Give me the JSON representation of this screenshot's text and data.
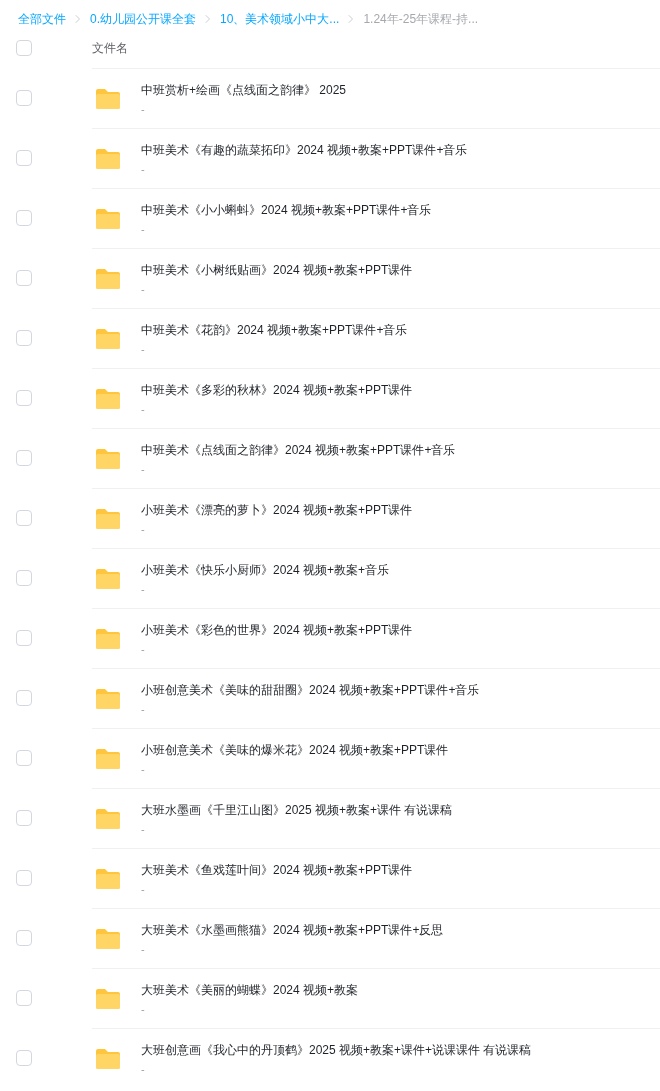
{
  "breadcrumb": [
    {
      "label": "全部文件",
      "selected": false
    },
    {
      "label": "0.幼儿园公开课全套",
      "selected": false
    },
    {
      "label": "10、美术领域小中大...",
      "selected": false
    },
    {
      "label": "1.24年-25年课程-持...",
      "selected": true
    }
  ],
  "table": {
    "select_all": {
      "checked": false
    },
    "columns": [
      "文件名"
    ],
    "rows": [
      {
        "name": "中班赏析+绘画《点线面之韵律》 2025",
        "detail": "-",
        "checked": false
      },
      {
        "name": "中班美术《有趣的蔬菜拓印》2024 视频+教案+PPT课件+音乐",
        "detail": "-",
        "checked": false
      },
      {
        "name": "中班美术《小小蝌蚪》2024 视频+教案+PPT课件+音乐",
        "detail": "-",
        "checked": false
      },
      {
        "name": "中班美术《小树纸贴画》2024 视频+教案+PPT课件",
        "detail": "-",
        "checked": false
      },
      {
        "name": "中班美术《花韵》2024 视频+教案+PPT课件+音乐",
        "detail": "-",
        "checked": false
      },
      {
        "name": "中班美术《多彩的秋林》2024 视频+教案+PPT课件",
        "detail": "-",
        "checked": false
      },
      {
        "name": "中班美术《点线面之韵律》2024 视频+教案+PPT课件+音乐",
        "detail": "-",
        "checked": false
      },
      {
        "name": "小班美术《漂亮的萝卜》2024 视频+教案+PPT课件",
        "detail": "-",
        "checked": false
      },
      {
        "name": "小班美术《快乐小厨师》2024 视频+教案+音乐",
        "detail": "-",
        "checked": false
      },
      {
        "name": "小班美术《彩色的世界》2024 视频+教案+PPT课件",
        "detail": "-",
        "checked": false
      },
      {
        "name": "小班创意美术《美味的甜甜圈》2024 视频+教案+PPT课件+音乐",
        "detail": "-",
        "checked": false
      },
      {
        "name": "小班创意美术《美味的爆米花》2024 视频+教案+PPT课件",
        "detail": "-",
        "checked": false
      },
      {
        "name": "大班水墨画《千里江山图》2025 视频+教案+课件 有说课稿",
        "detail": "-",
        "checked": false
      },
      {
        "name": "大班美术《鱼戏莲叶间》2024 视频+教案+PPT课件",
        "detail": "-",
        "checked": false
      },
      {
        "name": "大班美术《水墨画熊猫》2024 视频+教案+PPT课件+反思",
        "detail": "-",
        "checked": false
      },
      {
        "name": "大班美术《美丽的蝴蝶》2024 视频+教案",
        "detail": "-",
        "checked": false
      },
      {
        "name": "大班创意画《我心中的丹顶鹤》2025 视频+教案+课件+说课课件 有说课稿",
        "detail": "-",
        "checked": false
      }
    ]
  }
}
